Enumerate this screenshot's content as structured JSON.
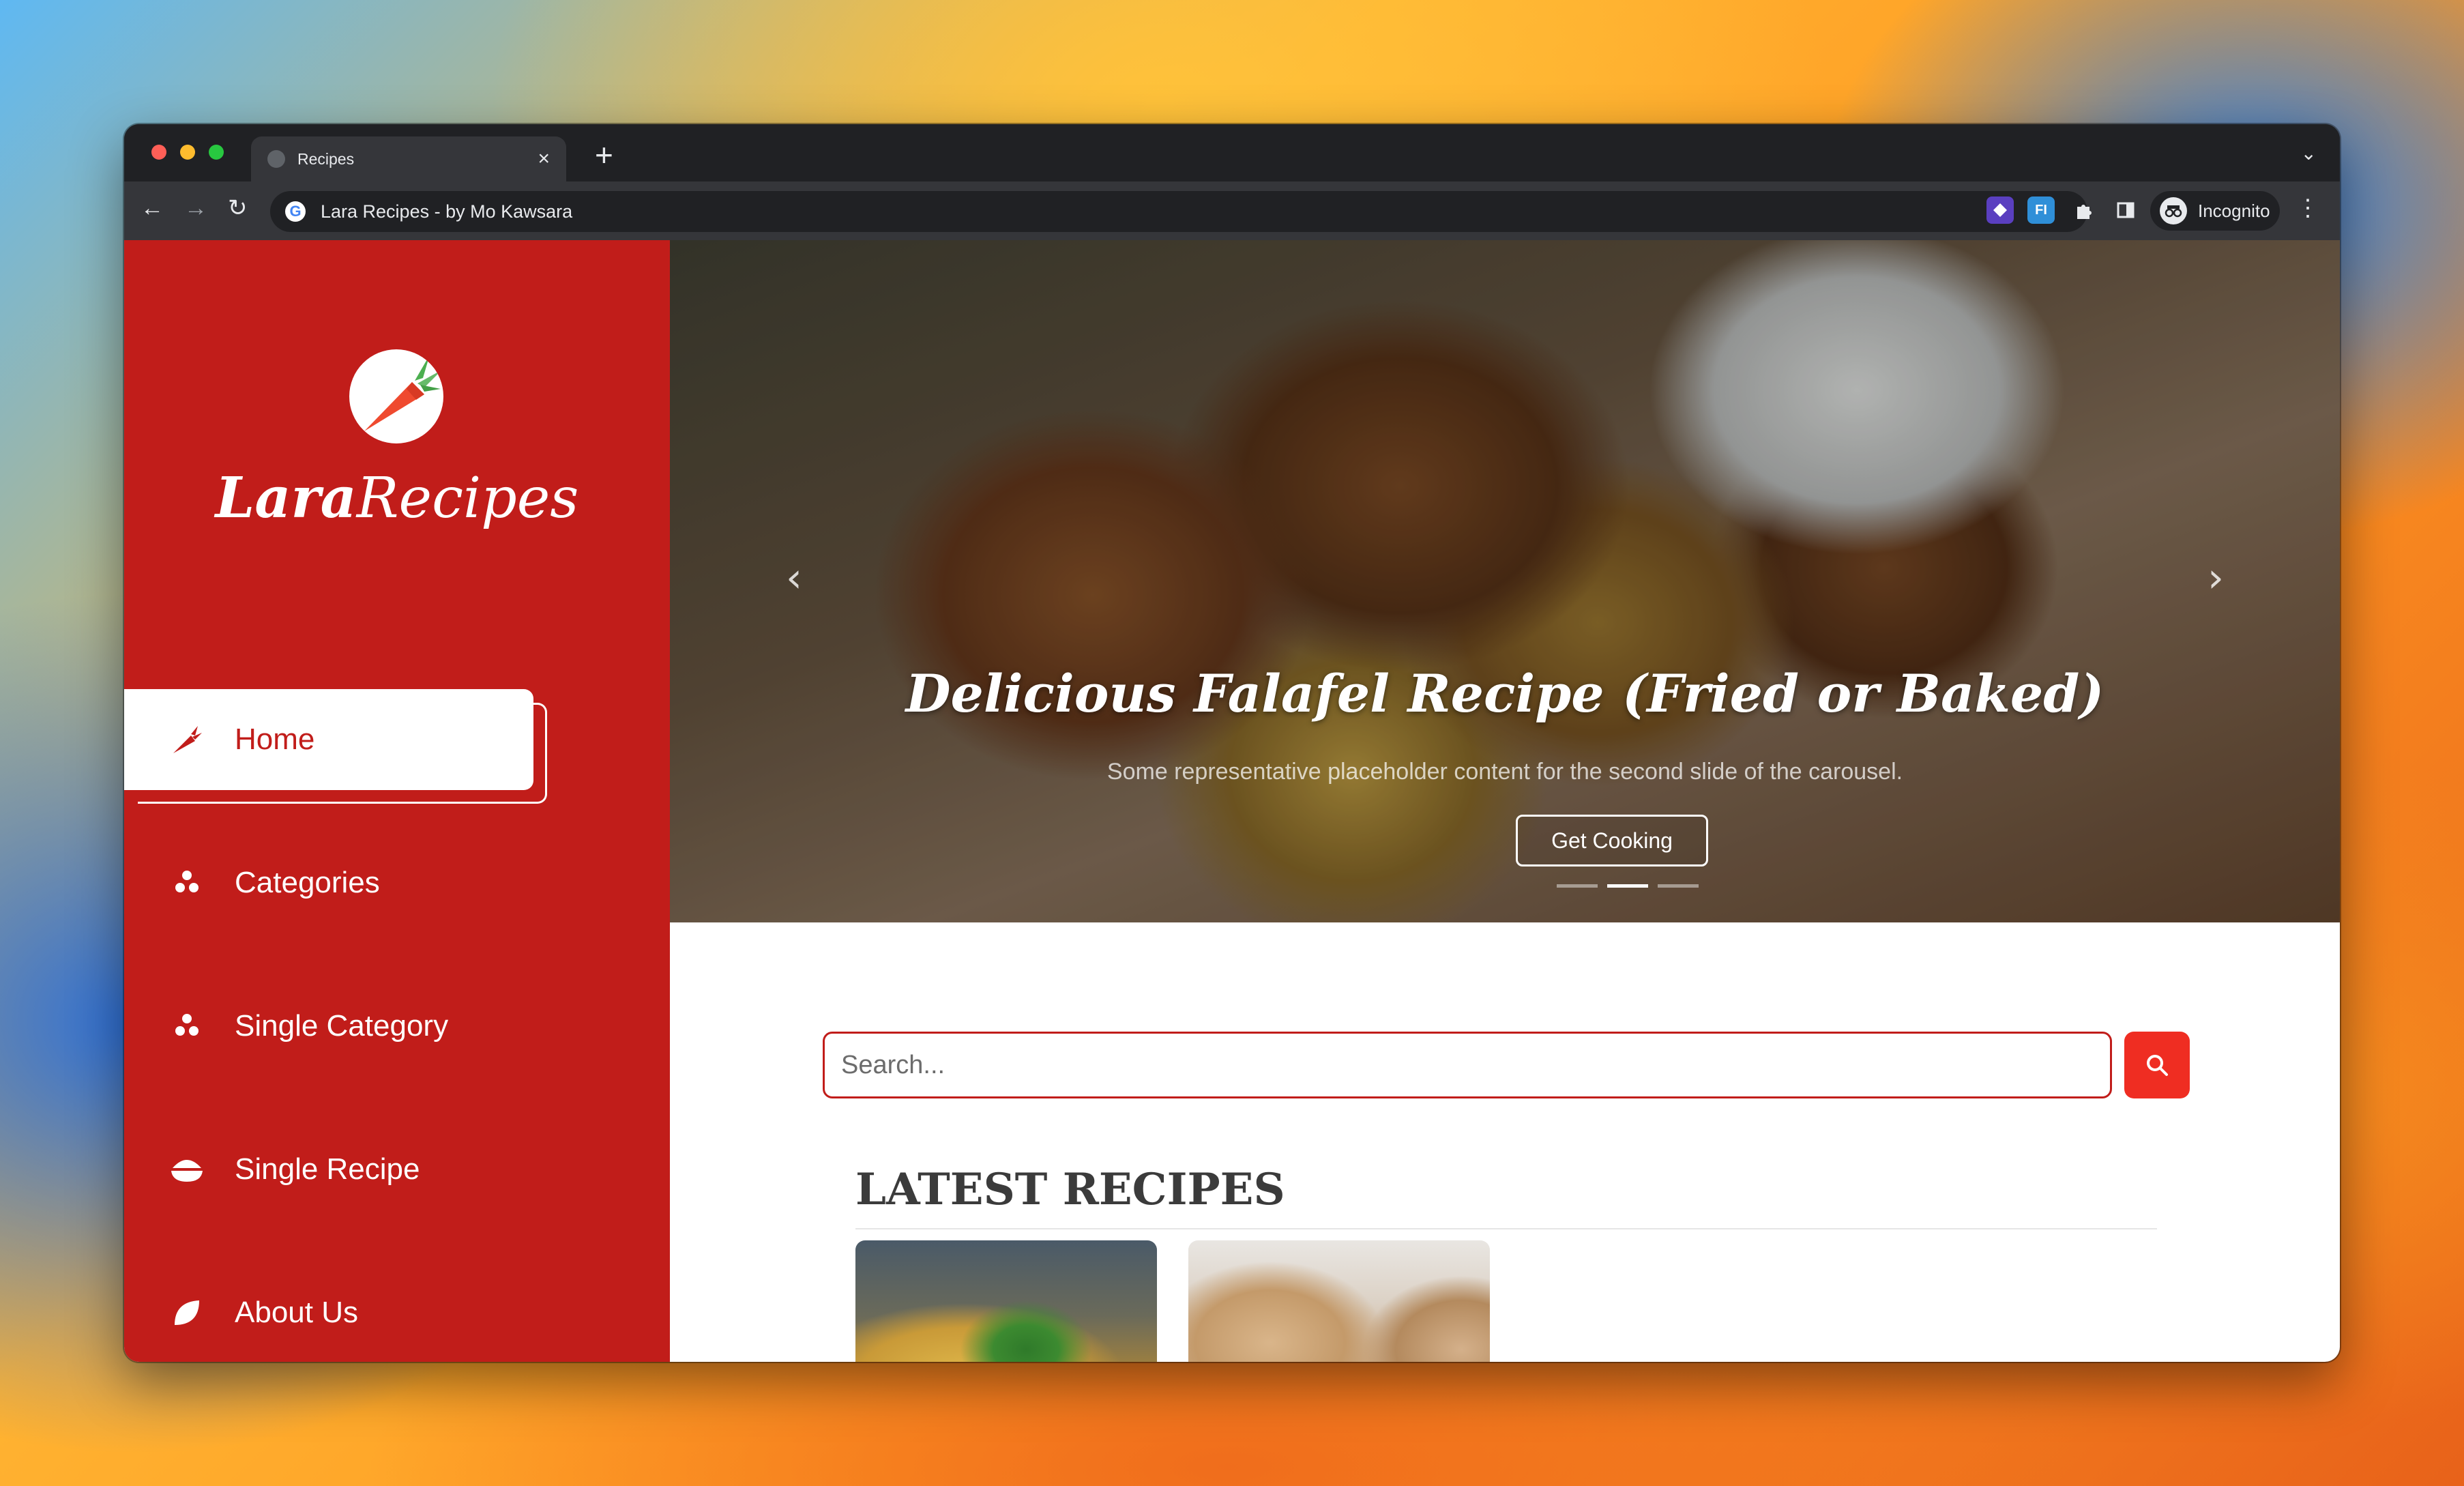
{
  "browser": {
    "tab_title": "Recipes",
    "tab_close": "×",
    "new_tab": "+",
    "tab_list": "⌄",
    "address": "Lara Recipes - by Mo Kawsara",
    "profile_label": "Incognito",
    "extension_badge": "FI",
    "nav": {
      "back": "←",
      "forward": "→",
      "reload": "↻",
      "menu": "⋮"
    }
  },
  "sidebar": {
    "brand_part1": "Lara",
    "brand_part2": "Recipes",
    "items": [
      {
        "label": "Home",
        "icon": "carrot-icon",
        "active": true
      },
      {
        "label": "Categories",
        "icon": "stack-icon"
      },
      {
        "label": "Single Category",
        "icon": "stack-icon"
      },
      {
        "label": "Single Recipe",
        "icon": "bowl-icon"
      },
      {
        "label": "About Us",
        "icon": "leaf-icon"
      }
    ]
  },
  "hero": {
    "title": "Delicious Falafel Recipe (Fried or Baked)",
    "subtitle": "Some representative placeholder content for the second slide of the carousel.",
    "button": "Get Cooking",
    "prev": "‹",
    "next": "›",
    "slides": 3,
    "active_slide": 2
  },
  "search": {
    "placeholder": "Search..."
  },
  "latest": {
    "title": "LATEST RECIPES"
  },
  "colors": {
    "brand_red": "#c11d1a",
    "search_button": "#ef2d22"
  }
}
